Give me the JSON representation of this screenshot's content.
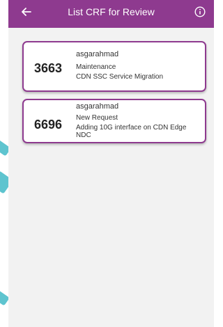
{
  "appbar": {
    "title": "List CRF for Review",
    "back_icon": "arrow-left-icon",
    "info_icon": "info-icon",
    "color": "#8e3a8f"
  },
  "crf_list": [
    {
      "id": "3663",
      "user": "asgarahmad",
      "type": "Maintenance",
      "description": "CDN SSC Service Migration"
    },
    {
      "id": "6696",
      "user": "asgarahmad",
      "type": "New Request",
      "description": "Adding 10G interface on CDN Edge NDC"
    }
  ]
}
